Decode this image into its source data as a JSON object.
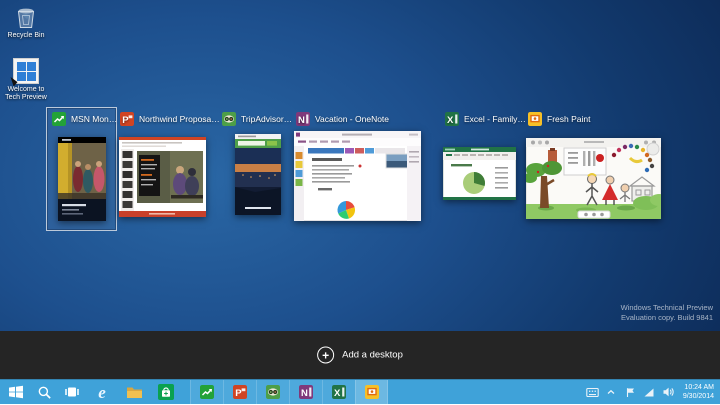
{
  "colors": {
    "taskbar_blue": "#3fa2d9",
    "task_strip": "#252525",
    "desktop_center": "#2a67a5",
    "desktop_edge": "#0c2752",
    "selection_border": "#bccadb",
    "msn_money_green": "#23a238",
    "powerpoint_orange": "#d04423",
    "tripadvisor_green": "#4d9e48",
    "onenote_purple": "#80397b",
    "excel_green": "#217346",
    "freshpaint_yellow": "#f7c028",
    "store_green": "#0aa14f"
  },
  "desktop": {
    "icons": [
      {
        "label": "Recycle Bin"
      },
      {
        "label_line1": "Welcome to",
        "label_line2": "Tech Preview"
      }
    ]
  },
  "task_view": {
    "windows": [
      {
        "label": "MSN Mon…",
        "app": "msn-money"
      },
      {
        "label": "Northwind Proposa…",
        "app": "powerpoint"
      },
      {
        "label": "TripAdvisor…",
        "app": "tripadvisor"
      },
      {
        "label": "Vacation - OneNote",
        "app": "onenote"
      },
      {
        "label": "Excel - Family…",
        "app": "excel"
      },
      {
        "label": "Fresh Paint",
        "app": "fresh-paint"
      }
    ],
    "add_desktop_label": "Add a desktop"
  },
  "watermark": {
    "line1": "Windows Technical Preview",
    "line2": "Evaluation copy. Build 9841"
  },
  "taskbar": {
    "clock": {
      "time": "10:24 AM",
      "date": "9/30/2014"
    }
  }
}
